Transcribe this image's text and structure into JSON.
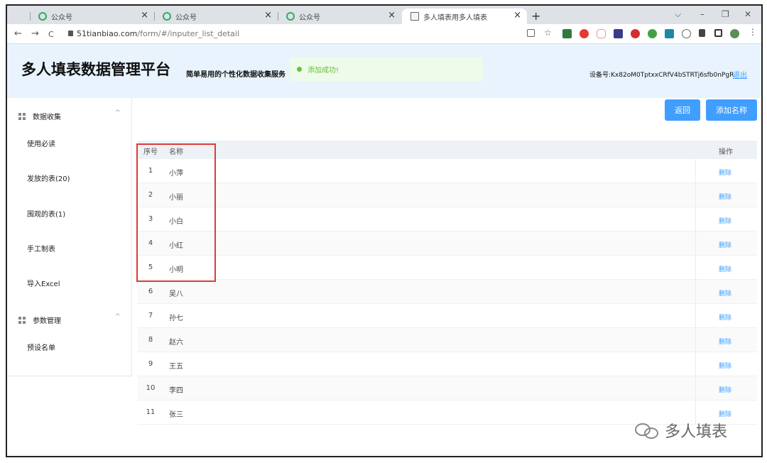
{
  "browser": {
    "tabs": [
      {
        "label": "公众号",
        "active": false
      },
      {
        "label": "公众号",
        "active": false
      },
      {
        "label": "公众号",
        "active": false
      },
      {
        "label": "多人填表用多人填表",
        "active": true
      }
    ],
    "new_tab": "+",
    "close_glyph": "×",
    "url_host": "51tianbiao.com",
    "url_path": "/form/#/inputer_list_detail",
    "window_controls": {
      "dropdown": "⌵",
      "minimize": "–",
      "restore": "❐",
      "close": "✕"
    },
    "nav": {
      "back": "←",
      "forward": "→",
      "reload": "C"
    }
  },
  "header": {
    "title": "多人填表数据管理平台",
    "subtitle": "简单易用的个性化数据收集服务",
    "toast": "添加成功!",
    "device": "设备号:Kx82oM0TptxxCRfV4bSTRTj6sfb0nPgR",
    "logout": "退出"
  },
  "sidebar": {
    "group1": {
      "label": "数据收集",
      "caret": "^"
    },
    "items1": [
      "使用必读",
      "发放的表(20)",
      "围观的表(1)",
      "手工制表",
      "导入Excel"
    ],
    "group2": {
      "label": "参数管理",
      "caret": "^"
    },
    "items2": [
      "预设名单"
    ]
  },
  "toolbar": {
    "back": "返回",
    "add_name": "添加名称"
  },
  "table": {
    "headers": {
      "index": "序号",
      "name": "名称",
      "action": "操作"
    },
    "rows": [
      {
        "index": "1",
        "name": "小萍",
        "action": "删除"
      },
      {
        "index": "2",
        "name": "小丽",
        "action": "删除"
      },
      {
        "index": "3",
        "name": "小白",
        "action": "删除"
      },
      {
        "index": "4",
        "name": "小红",
        "action": "删除"
      },
      {
        "index": "5",
        "name": "小明",
        "action": "删除"
      },
      {
        "index": "6",
        "name": "吴八",
        "action": "删除"
      },
      {
        "index": "7",
        "name": "孙七",
        "action": "删除"
      },
      {
        "index": "8",
        "name": "赵六",
        "action": "删除"
      },
      {
        "index": "9",
        "name": "王五",
        "action": "删除"
      },
      {
        "index": "10",
        "name": "李四",
        "action": "删除"
      },
      {
        "index": "11",
        "name": "张三",
        "action": "删除"
      }
    ]
  },
  "watermark": "多人填表",
  "colors": {
    "accent": "#409eff",
    "success": "#67c23a",
    "highlight": "#e03a3a",
    "header_bg": "#e8f3fd"
  }
}
